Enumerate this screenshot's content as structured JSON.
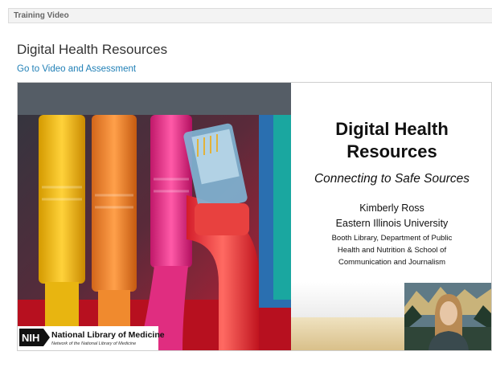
{
  "header": {
    "label": "Training Video"
  },
  "page": {
    "title": "Digital Health Resources",
    "link": "Go to Video and Assessment"
  },
  "video": {
    "slide_title_line1": "Digital  Health",
    "slide_title_line2": "Resources",
    "slide_subtitle": "Connecting to Safe Sources",
    "presenter": "Kimberly Ross",
    "university": "Eastern Illinois University",
    "department_line1": "Booth Library, Department of Public",
    "department_line2": "Health and Nutrition & School of",
    "department_line3": "Communication and Journalism",
    "logo_abbrev": "NIH",
    "logo_name": "National Library of Medicine",
    "logo_tagline": "Network of the National Library of Medicine"
  },
  "colors": {
    "link": "#1f7fb6",
    "title": "#333333",
    "header_bg": "#f3f3f3"
  }
}
